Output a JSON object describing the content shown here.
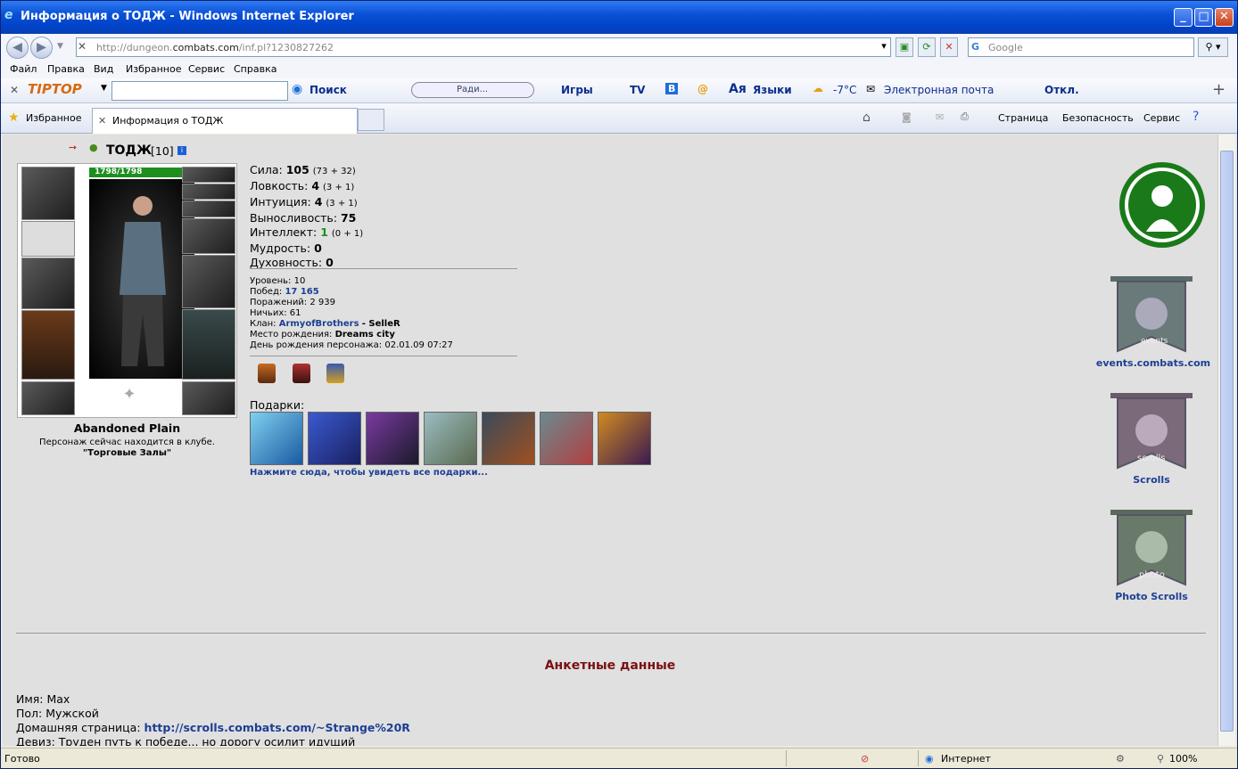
{
  "window": {
    "title": "Информация о ТОДЖ - Windows Internet Explorer"
  },
  "address": {
    "prefix": "http://dungeon.",
    "domain": "combats.com",
    "suffix": "/inf.pl?1230827262",
    "search_placeholder": "Google"
  },
  "menu": [
    "Файл",
    "Правка",
    "Вид",
    "Избранное",
    "Сервис",
    "Справка"
  ],
  "toolbar2": {
    "search_label": "Поиск",
    "radio_label": "Ради...",
    "games": "Игры",
    "tv": "TV",
    "languages": "Языки",
    "weather": "-7°C",
    "mail": "Электронная почта",
    "off": "Откл."
  },
  "toolbar3": {
    "favorites": "Избранное",
    "tab_title": "Информация о ТОДЖ",
    "page": "Страница",
    "safety": "Безопасность",
    "service": "Сервис"
  },
  "char": {
    "name": "ТОДЖ",
    "level_tag": "[10]",
    "hp": "1798/1798",
    "location": "Abandoned Plain",
    "club_text": "Персонаж сейчас находится в клубе.",
    "club_name": "\"Торговые Залы\""
  },
  "stats": [
    {
      "label": "Сила:",
      "value": "105",
      "detail": "(73 + 32)"
    },
    {
      "label": "Ловкость:",
      "value": "4",
      "detail": "(3 + 1)"
    },
    {
      "label": "Интуиция:",
      "value": "4",
      "detail": "(3 + 1)"
    },
    {
      "label": "Выносливость:",
      "value": "75",
      "detail": ""
    },
    {
      "label": "Интеллект:",
      "value": "1",
      "detail": "(0 + 1)"
    },
    {
      "label": "Мудрость:",
      "value": "0",
      "detail": ""
    },
    {
      "label": "Духовность:",
      "value": "0",
      "detail": ""
    }
  ],
  "info": {
    "level": "Уровень: 10",
    "wins_label": "Побед:",
    "wins": "17 165",
    "losses": "Поражений: 2 939",
    "draws": "Ничьих: 61",
    "clan_label": "Клан:",
    "clan": "ArmyofBrothers",
    "clan_role": "- SelleR",
    "birthplace_label": "Место рождения:",
    "birthplace": "Dreams city",
    "birthday": "День рождения персонажа: 02.01.09 07:27"
  },
  "gifts": {
    "label": "Подарки:",
    "link": "Нажмите сюда, чтобы увидеть все подарки..."
  },
  "right": {
    "events": "events.combats.com",
    "scrolls": "Scrolls",
    "photo": "Photo Scrolls",
    "events_banner": "events",
    "scrolls_banner": "scrolls",
    "photo_banner": "photo"
  },
  "profile": {
    "heading": "Анкетные данные",
    "name": "Имя: Max",
    "gender": "Пол: Мужской",
    "homepage_label": "Домашняя страница:",
    "homepage": "http://scrolls.combats.com/~Strange%20R",
    "motto": "Девиз: Труден путь к победе... но дорогу осилит идущий"
  },
  "status": {
    "ready": "Готово",
    "zone": "Интернет",
    "zoom": "100%"
  },
  "colors": {
    "link": "#1d3f93",
    "heading": "#7a1010",
    "hp": "#1e8f1e",
    "titlebar": "#0a51d6"
  }
}
